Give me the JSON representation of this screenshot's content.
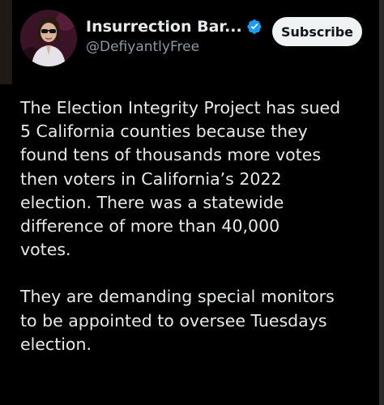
{
  "tweet": {
    "author": {
      "display_name": "Insurrection Bar...",
      "handle": "@DefiyantlyFree",
      "verified": true
    },
    "subscribe_label": "Subscribe",
    "paragraphs": [
      [
        "The Election Integrity Project has sued",
        "5 California counties because they",
        "found tens of thousands more votes",
        "then voters in California’s 2022",
        "election. There was a statewide",
        "difference of more than 40,000",
        "votes."
      ],
      [
        "They are demanding special monitors",
        "to be appointed to oversee Tuesdays",
        "election."
      ]
    ]
  },
  "colors": {
    "background": "#000000",
    "text": "#e7e9ea",
    "secondary_text": "#8b98a5",
    "verified_blue": "#1d9bf0",
    "subscribe_bg": "#eff3f4"
  }
}
